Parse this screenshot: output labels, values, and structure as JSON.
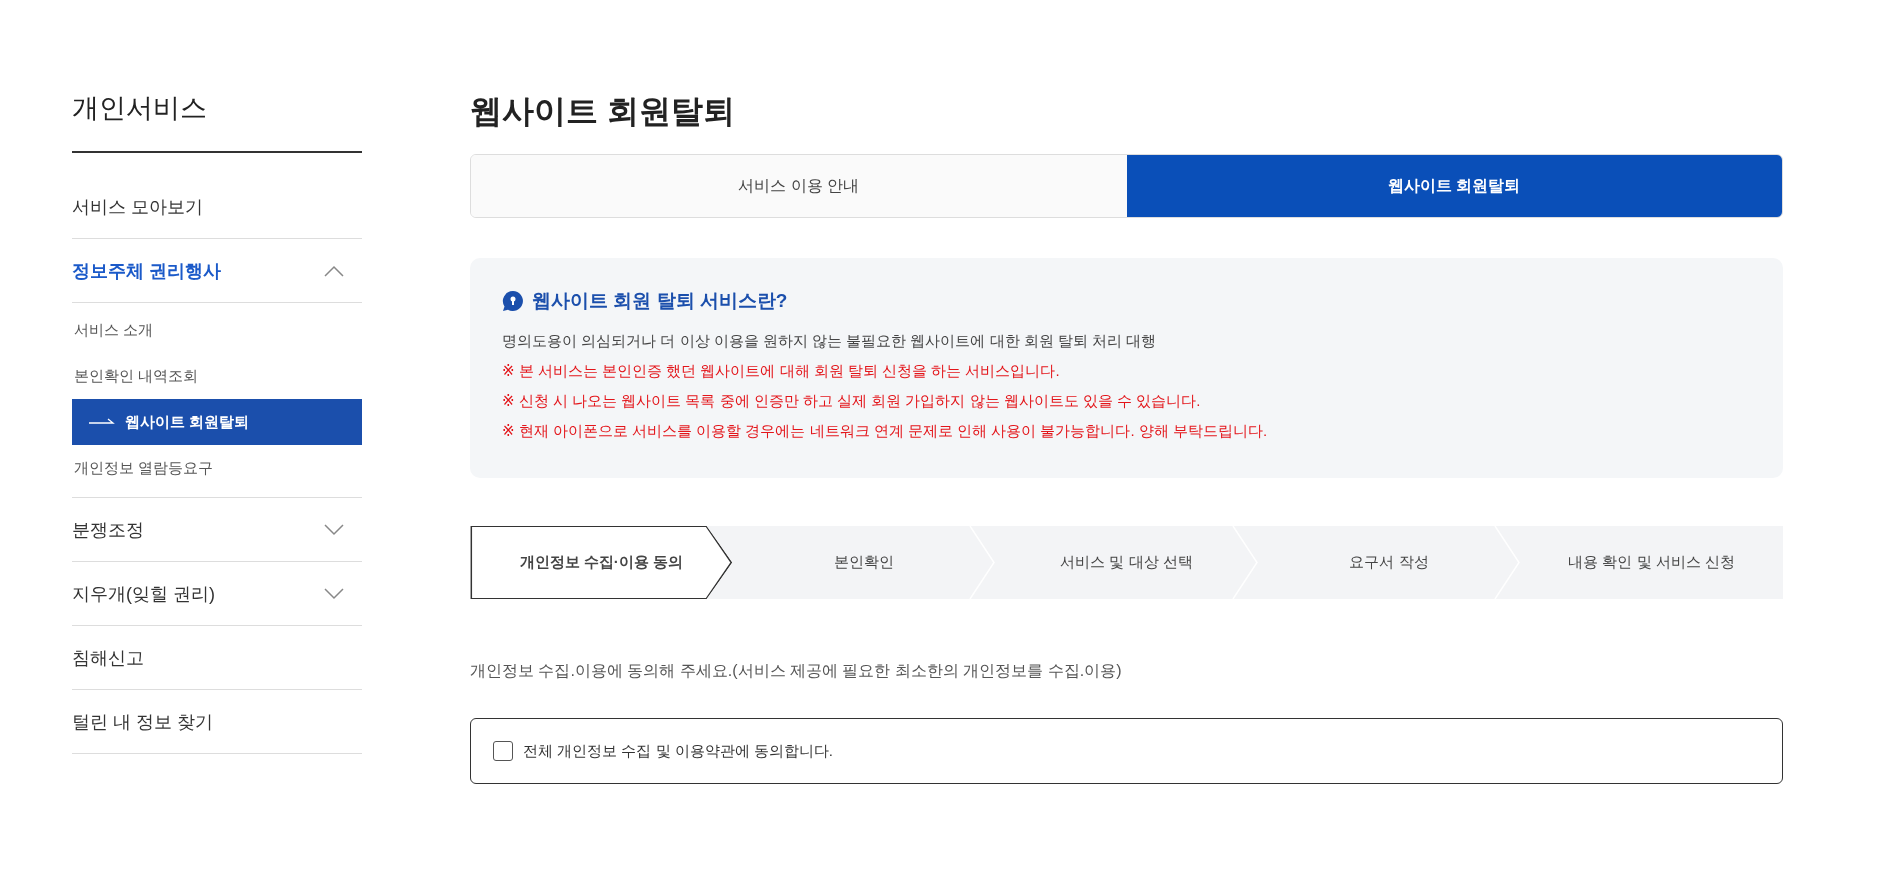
{
  "sidebar": {
    "title": "개인서비스",
    "items": [
      {
        "kind": "link",
        "label": "서비스 모아보기"
      },
      {
        "kind": "group",
        "label": "정보주체 권리행사",
        "expanded": true,
        "children": [
          {
            "label": "서비스 소개",
            "selected": false
          },
          {
            "label": "본인확인 내역조회",
            "selected": false
          },
          {
            "label": "웹사이트 회원탈퇴",
            "selected": true
          },
          {
            "label": "개인정보 열람등요구",
            "selected": false
          }
        ]
      },
      {
        "kind": "group",
        "label": "분쟁조정",
        "expanded": false
      },
      {
        "kind": "group",
        "label": "지우개(잊힐 권리)",
        "expanded": false
      },
      {
        "kind": "link",
        "label": "침해신고"
      },
      {
        "kind": "link",
        "label": "털린 내 정보 찾기"
      }
    ]
  },
  "page_title": "웹사이트 회원탈퇴",
  "tabs": [
    {
      "label": "서비스 이용 안내",
      "selected": false
    },
    {
      "label": "웹사이트 회원탈퇴",
      "selected": true
    }
  ],
  "info": {
    "heading": "웹사이트 회원 탈퇴 서비스란?",
    "lines": [
      {
        "kind": "normal",
        "text": "명의도용이 의심되거나 더 이상 이용을 원하지 않는 불필요한 웹사이트에 대한 회원 탈퇴 처리 대행"
      },
      {
        "kind": "warning",
        "text": "※ 본 서비스는 본인인증 했던 웹사이트에 대해 회원 탈퇴 신청을 하는 서비스입니다."
      },
      {
        "kind": "warning",
        "text": "※ 신청 시 나오는 웹사이트 목록 중에 인증만 하고 실제 회원 가입하지 않는 웹사이트도 있을 수 있습니다."
      },
      {
        "kind": "warning",
        "text": "※ 현재 아이폰으로 서비스를 이용할 경우에는 네트워크 연계 문제로 인해 사용이 불가능합니다. 양해 부탁드립니다."
      }
    ]
  },
  "steps": [
    {
      "label": "개인정보 수집·이용 동의",
      "selected": true
    },
    {
      "label": "본인확인",
      "selected": false
    },
    {
      "label": "서비스 및 대상 선택",
      "selected": false
    },
    {
      "label": "요구서 작성",
      "selected": false
    },
    {
      "label": "내용 확인 및 서비스 신청",
      "selected": false
    }
  ],
  "consent_intro": "개인정보 수집.이용에 동의해 주세요.(서비스 제공에 필요한 최소한의 개인정보를 수집.이용)",
  "consent_all": {
    "label": "전체 개인정보 수집 및 이용약관에 동의합니다.",
    "checked": false
  }
}
